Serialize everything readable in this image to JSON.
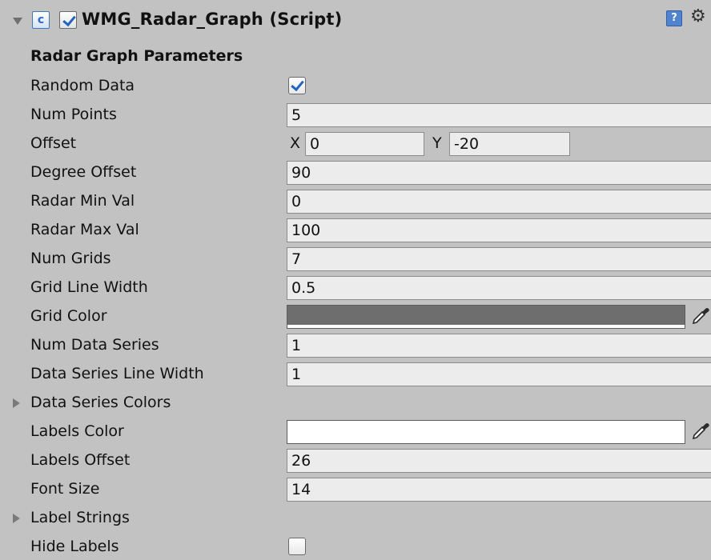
{
  "component": {
    "title": "WMG_Radar_Graph (Script)",
    "script_icon": "cs-script-icon",
    "enabled": true
  },
  "section_title": "Radar Graph Parameters",
  "fields": {
    "random_data": {
      "label": "Random Data",
      "checked": true
    },
    "num_points": {
      "label": "Num Points",
      "value": "5"
    },
    "offset": {
      "label": "Offset",
      "x_label": "X",
      "x_value": "0",
      "y_label": "Y",
      "y_value": "-20"
    },
    "degree_offset": {
      "label": "Degree Offset",
      "value": "90"
    },
    "radar_min_val": {
      "label": "Radar Min Val",
      "value": "0"
    },
    "radar_max_val": {
      "label": "Radar Max Val",
      "value": "100"
    },
    "num_grids": {
      "label": "Num Grids",
      "value": "7"
    },
    "grid_line_width": {
      "label": "Grid Line Width",
      "value": "0.5"
    },
    "grid_color": {
      "label": "Grid Color",
      "color": "#6e6e6e"
    },
    "num_data_series": {
      "label": "Num Data Series",
      "value": "1"
    },
    "data_series_line_width": {
      "label": "Data Series Line Width",
      "value": "1"
    },
    "data_series_colors": {
      "label": "Data Series Colors",
      "expanded": false
    },
    "labels_color": {
      "label": "Labels Color",
      "color": "#ffffff"
    },
    "labels_offset": {
      "label": "Labels Offset",
      "value": "26"
    },
    "font_size": {
      "label": "Font Size",
      "value": "14"
    },
    "label_strings": {
      "label": "Label Strings",
      "expanded": false
    },
    "hide_labels": {
      "label": "Hide Labels",
      "checked": false
    }
  },
  "icons": {
    "foldout": "foldout-arrow-icon",
    "help": "help-icon",
    "settings": "gear-icon",
    "eyedropper": "eyedropper-icon"
  }
}
